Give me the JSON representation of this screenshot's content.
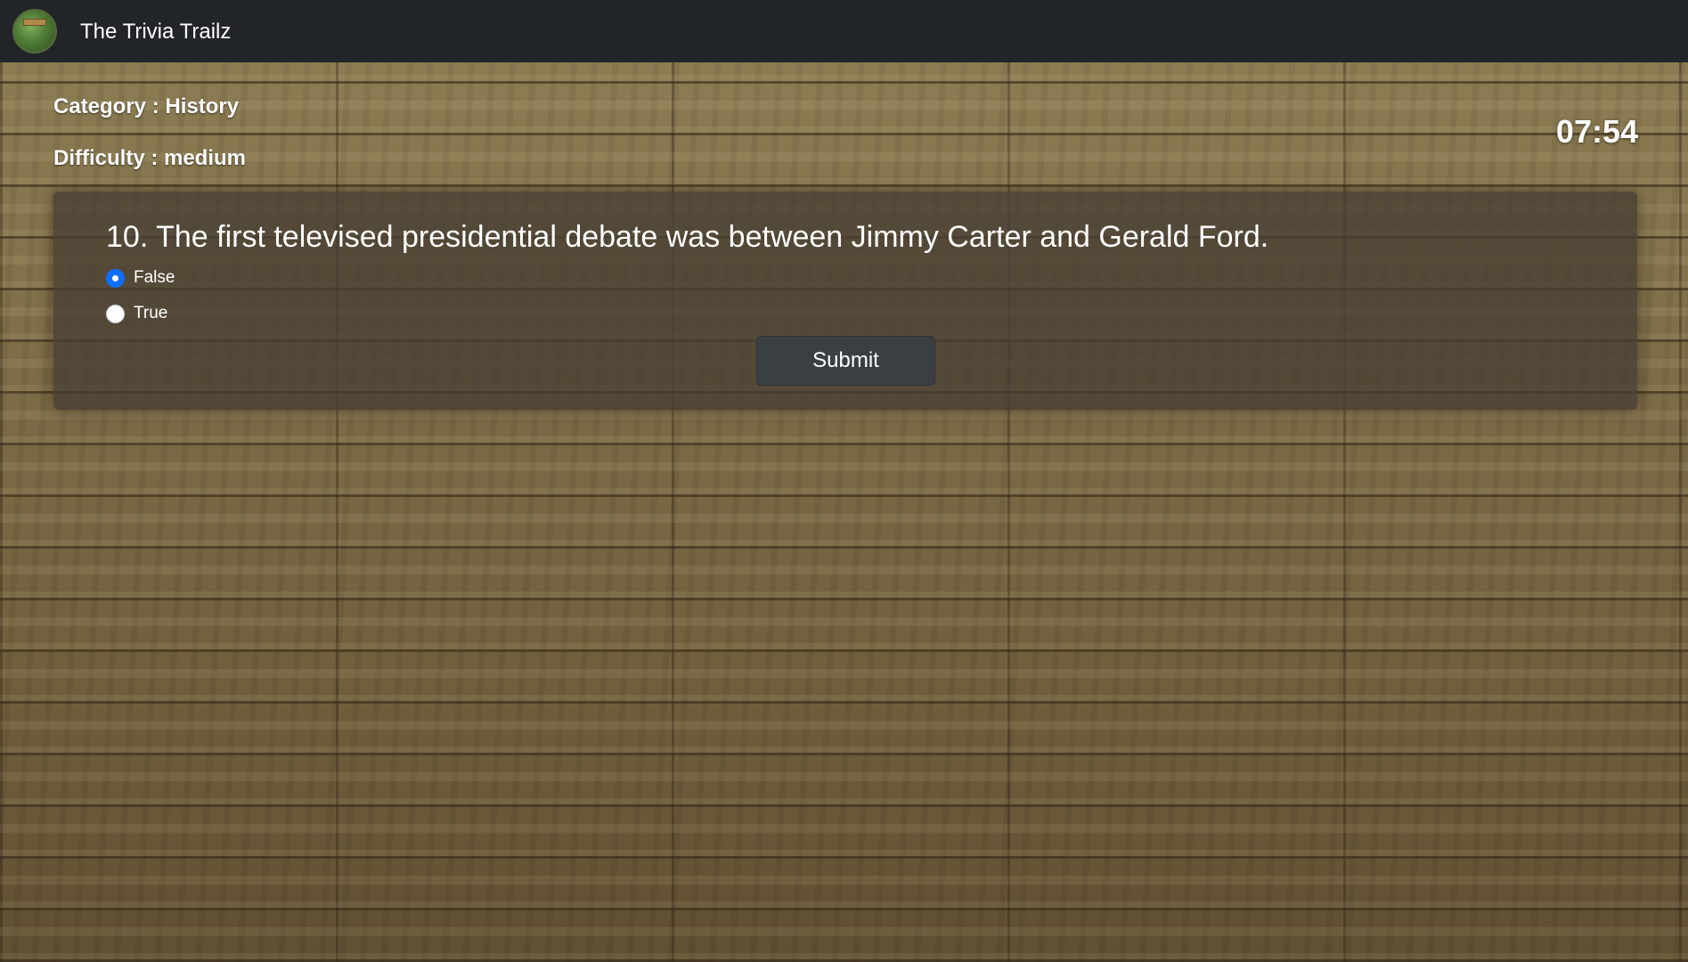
{
  "navbar": {
    "brand": "The Trivia Trailz",
    "logo_icon": "trail-sign-logo-icon"
  },
  "quiz": {
    "category_text": "Category : History",
    "difficulty_text": "Difficulty : medium",
    "timer": "07:54",
    "question": "10. The first televised presidential debate was between Jimmy Carter and Gerald Ford.",
    "options": [
      {
        "label": "False",
        "selected": true
      },
      {
        "label": "True",
        "selected": false
      }
    ],
    "submit_label": "Submit"
  },
  "colors": {
    "navbar_bg": "#212529",
    "radio_selected": "#0d6efd",
    "submit_bg": "#3a3f44"
  }
}
